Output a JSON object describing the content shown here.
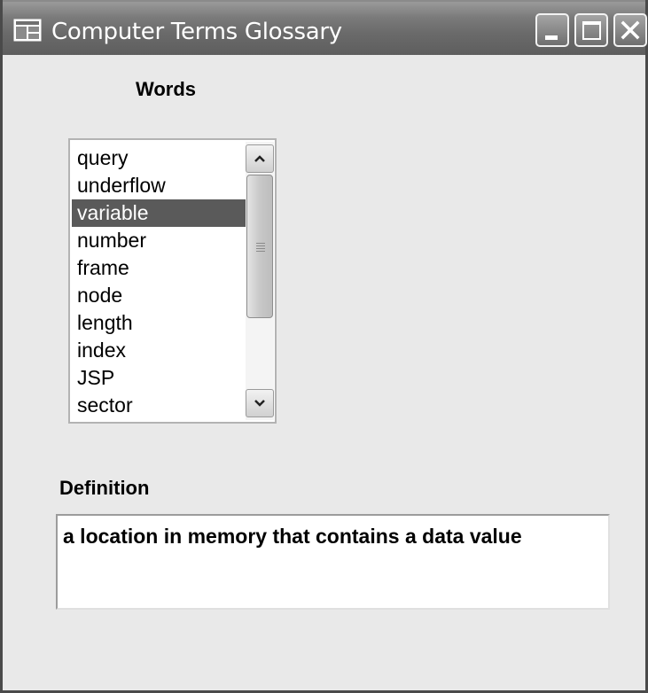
{
  "window": {
    "title": "Computer Terms Glossary",
    "icon": "application-window-icon",
    "controls": {
      "minimize": "minimize-icon",
      "maximize": "maximize-icon",
      "close": "close-icon"
    }
  },
  "words": {
    "label": "Words",
    "items": [
      "query",
      "underflow",
      "variable",
      "number",
      "frame",
      "node",
      "length",
      "index",
      "JSP",
      "sector"
    ],
    "selected": "variable"
  },
  "definition": {
    "label": "Definition",
    "text": "a location in memory that contains a data value"
  },
  "colors": {
    "window_background": "#e9e9e9",
    "selection_background": "#5a5a5a",
    "titlebar": "#6a6a6a"
  }
}
